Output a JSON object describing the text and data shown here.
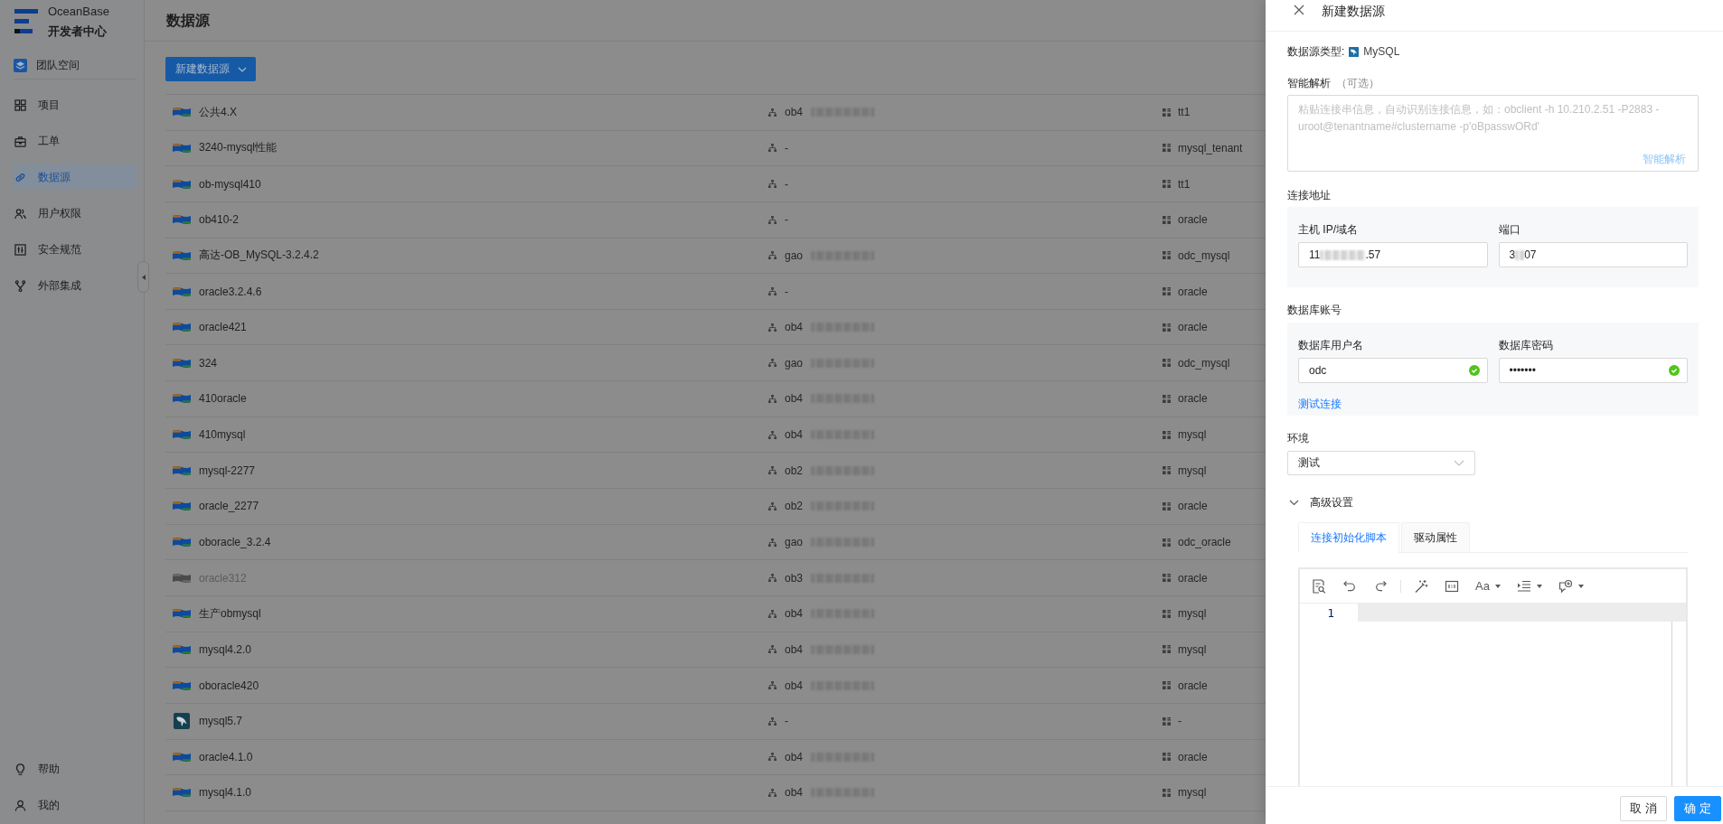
{
  "sidebar": {
    "brand": {
      "name": "OceanBase",
      "subtitle": "开发者中心"
    },
    "workspace": {
      "label": "团队空间"
    },
    "items": [
      {
        "label": "项目",
        "selected": false
      },
      {
        "label": "工单",
        "selected": false
      },
      {
        "label": "数据源",
        "selected": true
      },
      {
        "label": "用户权限",
        "selected": false
      },
      {
        "label": "安全规范",
        "selected": false
      },
      {
        "label": "外部集成",
        "selected": false
      }
    ],
    "footer_items": [
      {
        "label": "帮助"
      },
      {
        "label": "我的"
      }
    ]
  },
  "page": {
    "title": "数据源",
    "new_button": {
      "label": "新建数据源"
    },
    "rows": [
      {
        "kind": "oceanbase",
        "name": "公共4.X",
        "disabled": false,
        "host": {
          "text": "ob4",
          "redacted": true
        },
        "tenant": "tt1"
      },
      {
        "kind": "oceanbase",
        "name": "3240-mysql性能",
        "disabled": false,
        "host": {
          "text": "-",
          "redacted": false
        },
        "tenant": "mysql_tenant"
      },
      {
        "kind": "oceanbase",
        "name": "ob-mysql410",
        "disabled": false,
        "host": {
          "text": "-",
          "redacted": false
        },
        "tenant": "tt1"
      },
      {
        "kind": "oceanbase",
        "name": "ob410-2",
        "disabled": false,
        "host": {
          "text": "-",
          "redacted": false
        },
        "tenant": "oracle"
      },
      {
        "kind": "oceanbase",
        "name": "高达-OB_MySQL-3.2.4.2",
        "disabled": false,
        "host": {
          "text": "gao",
          "redacted": true
        },
        "tenant": "odc_mysql"
      },
      {
        "kind": "oceanbase",
        "name": "oracle3.2.4.6",
        "disabled": false,
        "host": {
          "text": "-",
          "redacted": false
        },
        "tenant": "oracle"
      },
      {
        "kind": "oceanbase",
        "name": "oracle421",
        "disabled": false,
        "host": {
          "text": "ob4",
          "redacted": true
        },
        "tenant": "oracle"
      },
      {
        "kind": "oceanbase",
        "name": "324",
        "disabled": false,
        "host": {
          "text": "gao",
          "redacted": true
        },
        "tenant": "odc_mysql"
      },
      {
        "kind": "oceanbase",
        "name": "410oracle",
        "disabled": false,
        "host": {
          "text": "ob4",
          "redacted": true
        },
        "tenant": "oracle"
      },
      {
        "kind": "oceanbase",
        "name": "410mysql",
        "disabled": false,
        "host": {
          "text": "ob4",
          "redacted": true
        },
        "tenant": "mysql"
      },
      {
        "kind": "oceanbase",
        "name": "mysql-2277",
        "disabled": false,
        "host": {
          "text": "ob2",
          "redacted": true
        },
        "tenant": "mysql"
      },
      {
        "kind": "oceanbase",
        "name": "oracle_2277",
        "disabled": false,
        "host": {
          "text": "ob2",
          "redacted": true
        },
        "tenant": "oracle"
      },
      {
        "kind": "oceanbase",
        "name": "oboracle_3.2.4",
        "disabled": false,
        "host": {
          "text": "gao",
          "redacted": true
        },
        "tenant": "odc_oracle"
      },
      {
        "kind": "oceanbase",
        "name": "oracle312",
        "disabled": true,
        "host": {
          "text": "ob3",
          "redacted": true
        },
        "tenant": "oracle"
      },
      {
        "kind": "oceanbase",
        "name": "生产obmysql",
        "disabled": false,
        "host": {
          "text": "ob4",
          "redacted": true
        },
        "tenant": "mysql"
      },
      {
        "kind": "oceanbase",
        "name": "mysql4.2.0",
        "disabled": false,
        "host": {
          "text": "ob4",
          "redacted": true
        },
        "tenant": "mysql"
      },
      {
        "kind": "oceanbase",
        "name": "oboracle420",
        "disabled": false,
        "host": {
          "text": "ob4",
          "redacted": true
        },
        "tenant": "oracle"
      },
      {
        "kind": "mysql",
        "name": "mysql5.7",
        "disabled": false,
        "host": {
          "text": "-",
          "redacted": false
        },
        "tenant": "-"
      },
      {
        "kind": "oceanbase",
        "name": "oracle4.1.0",
        "disabled": false,
        "host": {
          "text": "ob4",
          "redacted": true
        },
        "tenant": "oracle"
      },
      {
        "kind": "oceanbase",
        "name": "mysql4.1.0",
        "disabled": false,
        "host": {
          "text": "ob4",
          "redacted": true
        },
        "tenant": "mysql"
      }
    ]
  },
  "drawer": {
    "title": "新建数据源",
    "type_label": "数据源类型:",
    "type_value": "MySQL",
    "parse": {
      "label": "智能解析",
      "optional": "（可选）",
      "placeholder": "粘贴连接串信息，自动识别连接信息，如：obclient -h 10.210.2.51 -P2883 -uroot@tenantname#clustername -p'oBpasswORd'",
      "action": "智能解析"
    },
    "address": {
      "label": "连接地址",
      "host": {
        "label": "主机 IP/域名",
        "visible_parts": [
          "11",
          ".57"
        ]
      },
      "port": {
        "label": "端口",
        "visible_parts": [
          "3",
          "07"
        ]
      }
    },
    "account": {
      "label": "数据库账号",
      "username": {
        "label": "数据库用户名",
        "value": "odc",
        "valid": true
      },
      "password": {
        "label": "数据库密码",
        "value": "•••••••",
        "valid": true
      },
      "test_link": "测试连接"
    },
    "environment": {
      "label": "环境",
      "value": "测试"
    },
    "advanced": {
      "label": "高级设置",
      "expanded": true,
      "tabs": [
        {
          "label": "连接初始化脚本",
          "selected": true
        },
        {
          "label": "驱动属性",
          "selected": false
        }
      ],
      "editor": {
        "font_button_label": "Aa",
        "line_numbers": [
          "1"
        ]
      }
    },
    "buttons": [
      {
        "label": "取 消",
        "kind": "default"
      },
      {
        "label": "确 定",
        "kind": "primary"
      }
    ]
  }
}
